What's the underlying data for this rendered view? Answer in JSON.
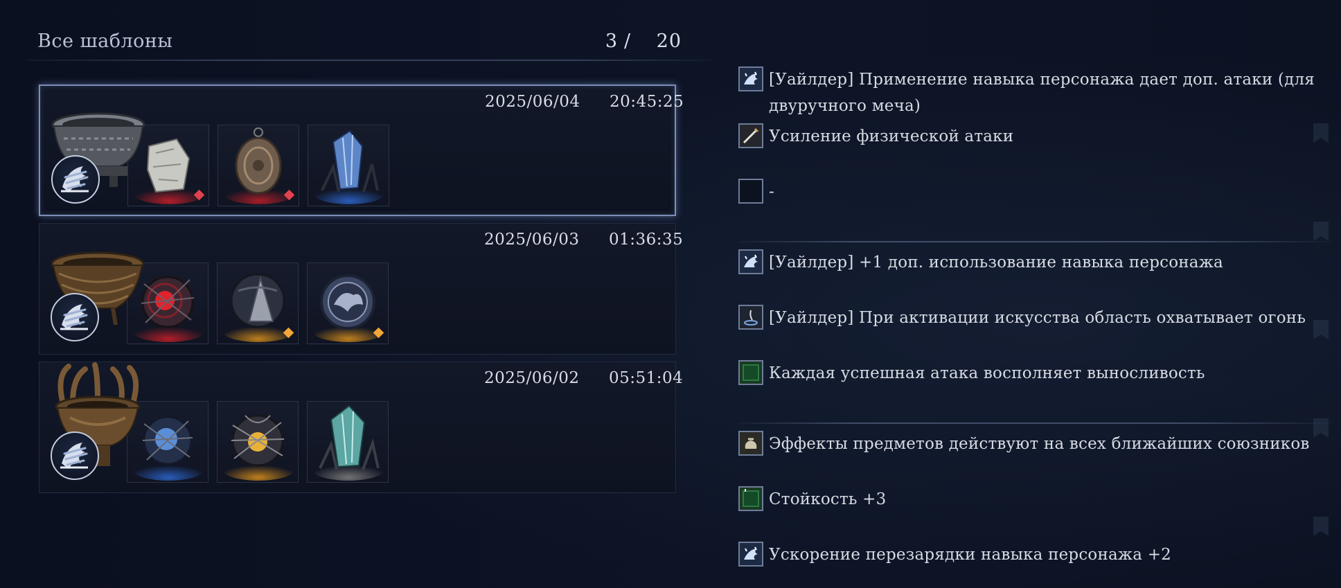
{
  "list": {
    "title": "Все шаблоны",
    "count_current": "3",
    "count_separator": "/",
    "count_total": "20"
  },
  "presets": [
    {
      "date": "2025/06/04",
      "time": "20:45:25",
      "selected": true,
      "vessel": "stone-chalice",
      "relics": [
        {
          "icon": "white-stone-relic",
          "glow": "#c0202a",
          "badge": "#e0434e"
        },
        {
          "icon": "bronze-medallion-relic",
          "glow": "#b51f28",
          "badge": "#e0434e"
        },
        {
          "icon": "blue-crystal-relic",
          "glow": "#2c64c8",
          "badge": ""
        }
      ]
    },
    {
      "date": "2025/06/03",
      "time": "01:36:35",
      "selected": false,
      "vessel": "wicker-chalice",
      "relics": [
        {
          "icon": "red-thorn-orb-relic",
          "glow": "#c0202a",
          "badge": ""
        },
        {
          "icon": "grey-blade-relic",
          "glow": "#d08a1c",
          "badge": "#f0a63a"
        },
        {
          "icon": "dragon-medallion-relic",
          "glow": "#d08a1c",
          "badge": "#f0a63a"
        }
      ]
    },
    {
      "date": "2025/06/02",
      "time": "05:51:04",
      "selected": false,
      "vessel": "antler-chalice",
      "relics": [
        {
          "icon": "blue-thorn-orb-relic",
          "glow": "#2c64c8",
          "badge": ""
        },
        {
          "icon": "gold-thorn-orb-relic",
          "glow": "#d08a1c",
          "badge": ""
        },
        {
          "icon": "teal-crystal-relic",
          "glow": "#7c7c7c",
          "badge": ""
        }
      ]
    }
  ],
  "effects": [
    {
      "icon": "character-skill-icon",
      "text": "[Уайлдер] Применение навыка персонажа дает доп. атаки (для двуручного меча)"
    },
    {
      "icon": "sword-icon",
      "text": "Усиление физической атаки"
    },
    {
      "icon": "empty-slot-icon",
      "text": "-"
    },
    {
      "icon": "character-skill-icon",
      "text": "[Уайлдер] +1 доп. использование навыка персонажа"
    },
    {
      "icon": "art-flame-icon",
      "text": "[Уайлдер] При активации искусства область охватывает огонь"
    },
    {
      "icon": "stamina-green-icon",
      "text": "Каждая успешная атака восполняет выносливость"
    },
    {
      "icon": "pouch-icon",
      "text": "Эффекты предметов действуют на всех ближайших союзников"
    },
    {
      "icon": "stat-up-green-icon",
      "text": "Стойкость +3"
    },
    {
      "icon": "character-skill-icon",
      "text": "Ускорение перезарядки навыка персонажа +2"
    }
  ]
}
